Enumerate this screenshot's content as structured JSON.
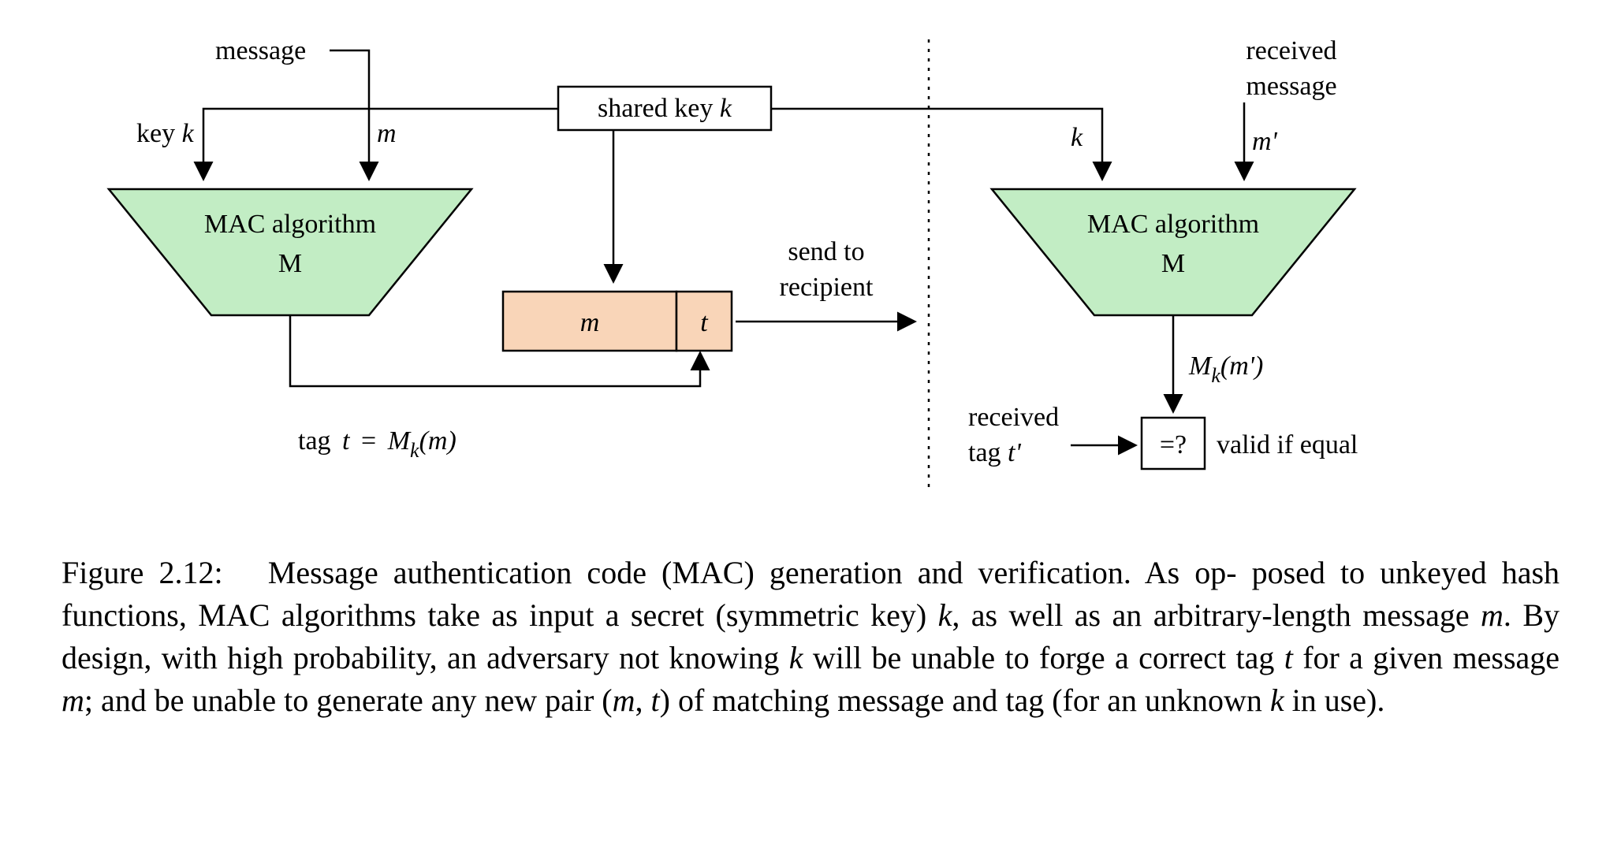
{
  "labels": {
    "message": "message",
    "key_k": "key",
    "key_k_var": "k",
    "m_var": "m",
    "shared_key": "shared key",
    "shared_key_var": "k",
    "mac_algorithm": "MAC algorithm",
    "mac_M": "M",
    "send_to": "send to",
    "recipient": "recipient",
    "tag_eq_pre": "tag",
    "tag_t_var": "t",
    "tag_eq_mid": "=",
    "tag_M_var": "M",
    "tag_sub_k": "k",
    "tag_arg_m": "(m)",
    "t_var": "t",
    "received": "received",
    "received_msg": "message",
    "k_var": "k",
    "mprime_var": "m'",
    "Mk_mprime_M": "M",
    "Mk_mprime_k": "k",
    "Mk_mprime_arg": "(m')",
    "received_tag": "received",
    "tag_tprime": "tag",
    "tprime_var": "t'",
    "eqq": "=?",
    "valid": "valid if equal"
  },
  "caption": {
    "fig_label": "Figure 2.12:",
    "line1a": "Message authentication code (MAC) generation and verification.  As op-",
    "line2a": "posed to unkeyed hash functions, MAC algorithms take as input a secret (symmetric key)",
    "line3a_k": "k",
    "line3b": ", as well as an arbitrary-length message ",
    "line3c_m": "m",
    "line3d": ".  By design, with high probability, an adversary",
    "line4a": "not knowing ",
    "line4b_k": "k",
    "line4c": " will be unable to forge a correct tag ",
    "line4d_t": "t",
    "line4e": " for a given message ",
    "line4f_m": "m",
    "line4g": "; and be unable",
    "line5a": "to generate any new pair (",
    "line5b_m": "m",
    "line5c": ", ",
    "line5d_t": "t",
    "line5e": ") of matching message and tag (for an unknown ",
    "line5f_k": "k",
    "line5g": " in use)."
  }
}
